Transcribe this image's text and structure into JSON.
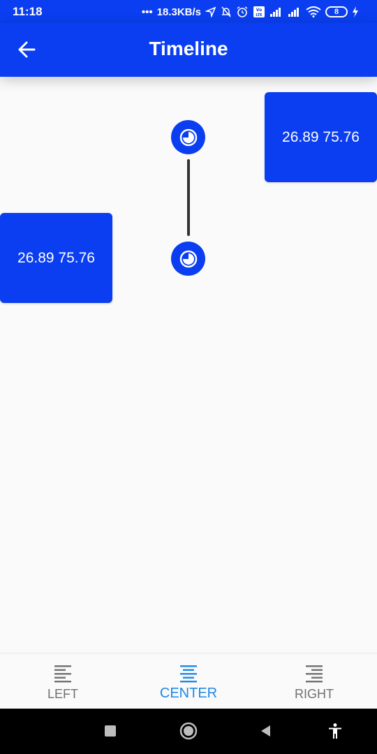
{
  "status_bar": {
    "time": "11:18",
    "network_speed": "18.3KB/s",
    "battery_level": "8",
    "icons": [
      "location-icon",
      "mute-icon",
      "alarm-icon",
      "volte-icon",
      "signal-icon",
      "signal-icon",
      "wifi-icon",
      "battery-icon",
      "charging-icon"
    ]
  },
  "app_bar": {
    "title": "Timeline",
    "back_icon": "arrow-back-icon"
  },
  "timeline": {
    "items": [
      {
        "side": "right",
        "text": "26.89 75.76",
        "icon": "clock-icon"
      },
      {
        "side": "left",
        "text": "26.89 75.76",
        "icon": "clock-icon"
      }
    ]
  },
  "bottom_nav": {
    "items": [
      {
        "label": "LEFT",
        "icon": "align-left-icon",
        "selected": false
      },
      {
        "label": "CENTER",
        "icon": "align-center-icon",
        "selected": true
      },
      {
        "label": "RIGHT",
        "icon": "align-right-icon",
        "selected": false
      }
    ]
  },
  "system_nav": {
    "buttons": [
      "recents-icon",
      "home-icon",
      "back-icon",
      "accessibility-icon"
    ]
  },
  "colors": {
    "primary": "#0a3ef0",
    "selected_nav": "#1e88e5",
    "unselected_nav": "#707070",
    "background": "#fafafa"
  }
}
